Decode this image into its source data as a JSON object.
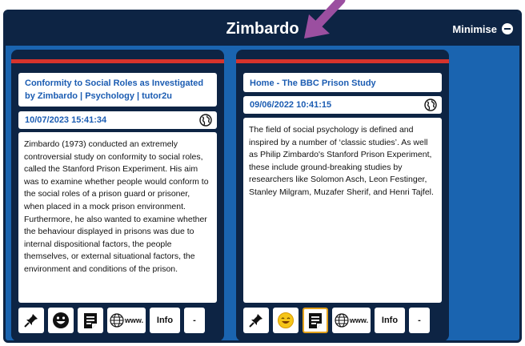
{
  "window": {
    "title": "Zimbardo",
    "minimise_label": "Minimise"
  },
  "cards": [
    {
      "title": "Conformity to Social Roles as Investigated by Zimbardo | Psychology | tutor2u",
      "date": "10/07/2023 15:41:34",
      "body": "Zimbardo (1973) conducted an extremely controversial study on conformity to social roles, called the Stanford Prison Experiment. His aim was to examine whether people would conform to the social roles of a prison guard or prisoner, when placed in a mock prison environment. Furthermore, he also wanted to examine whether the behaviour displayed in prisons was due to internal dispositional factors, the people themselves, or external situational factors, the environment and conditions of the prison.",
      "toolbar": {
        "www_label": "www.",
        "info_label": "Info",
        "dropdown_label": "-"
      }
    },
    {
      "title": "Home - The BBC Prison Study",
      "date": "09/06/2022 10:41:15",
      "body": "The field of social psychology is defined and inspired by a number of ‘classic studies’. As well as Philip Zimbardo's Stanford Prison Experiment, these include ground-breaking studies by researchers like Solomon Asch, Leon Festinger, Stanley Milgram, Muzafer Sherif, and Henri Tajfel.",
      "toolbar": {
        "www_label": "www.",
        "info_label": "Info",
        "dropdown_label": "-"
      }
    }
  ],
  "colors": {
    "window_bg": "#1a64b0",
    "titlebar_bg": "#0d2444",
    "accent_red": "#d6332c",
    "link_blue": "#1b5cb2",
    "highlight_orange": "#e4a21c",
    "arrow_purple": "#9b4fa0"
  }
}
